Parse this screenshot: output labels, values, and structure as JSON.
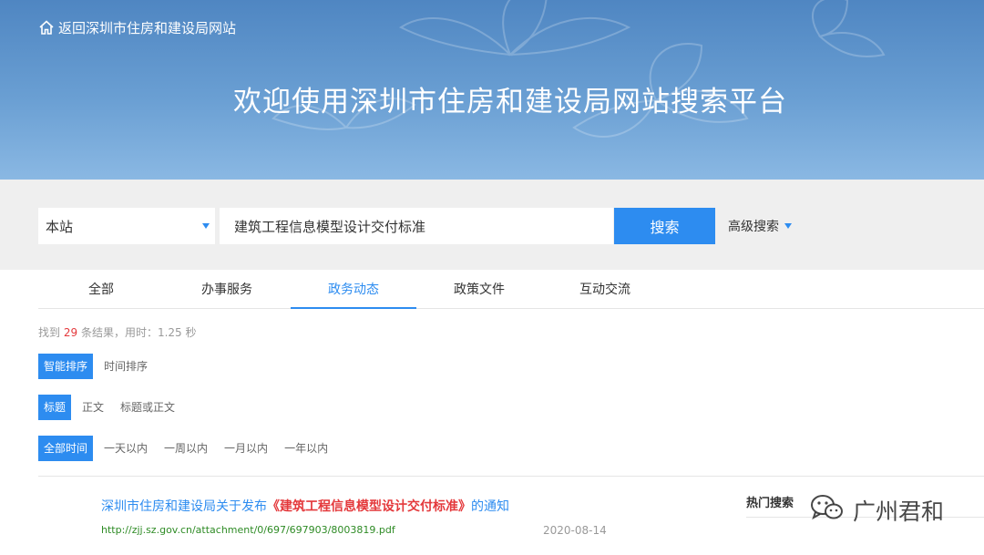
{
  "header": {
    "back_link": "返回深圳市住房和建设局网站",
    "welcome": "欢迎使用深圳市住房和建设局网站搜索平台"
  },
  "search": {
    "scope": "本站",
    "query": "建筑工程信息模型设计交付标准",
    "button": "搜索",
    "advanced": "高级搜索"
  },
  "tabs": [
    {
      "label": "全部",
      "active": false
    },
    {
      "label": "办事服务",
      "active": false
    },
    {
      "label": "政务动态",
      "active": true
    },
    {
      "label": "政策文件",
      "active": false
    },
    {
      "label": "互动交流",
      "active": false
    }
  ],
  "stats": {
    "prefix": "找到",
    "count": "29",
    "suffix": "条结果，用时：1.25 秒"
  },
  "filters": {
    "sort": [
      "智能排序",
      "时间排序"
    ],
    "field": [
      "标题",
      "正文",
      "标题或正文"
    ],
    "time": [
      "全部时间",
      "一天以内",
      "一周以内",
      "一月以内",
      "一年以内"
    ]
  },
  "result": {
    "title_prefix": "深圳市住房和建设局关于发布",
    "title_highlight": "《建筑工程信息模型设计交付标准》",
    "title_suffix": "的通知",
    "url": "http://zjj.sz.gov.cn/attachment/0/697/697903/8003819.pdf",
    "date": "2020-08-14"
  },
  "sidebar": {
    "hot_search": "热门搜索"
  },
  "watermark": "广州君和",
  "colors": {
    "accent": "#2d8cf0",
    "highlight": "#e4393c",
    "url_green": "#2e8b25"
  }
}
